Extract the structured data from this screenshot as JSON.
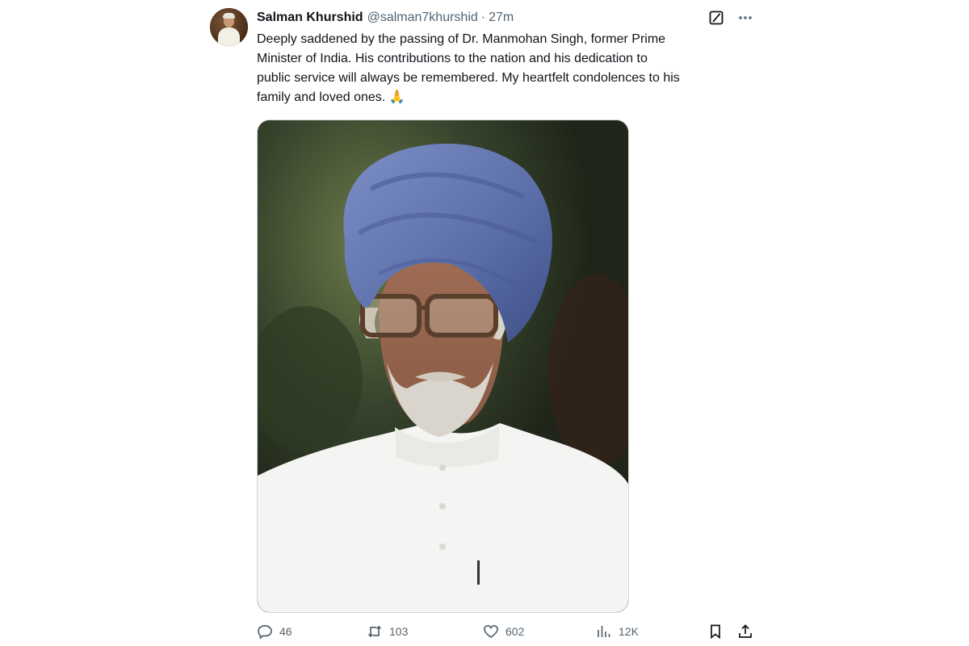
{
  "tweet": {
    "author_name": "Salman Khurshid",
    "author_handle": "@salman7khurshid",
    "separator": "·",
    "time": "27m",
    "text": "Deeply saddened by the passing of Dr. Manmohan Singh, former Prime\nMinister of India. His contributions to the nation and his dedication to\npublic service will always be remembered. My heartfelt condolences to his\nfamily and loved ones. 🙏"
  },
  "top_actions": {
    "grok_icon": "grok-icon",
    "more_icon": "more-icon"
  },
  "media": {
    "subject": "photo-portrait"
  },
  "metrics": {
    "replies": "46",
    "reposts": "103",
    "likes": "602",
    "views": "12K"
  },
  "icons": {
    "reply": "reply-icon",
    "repost": "repost-icon",
    "like": "heart-icon",
    "views": "views-icon",
    "bookmark": "bookmark-icon",
    "share": "share-icon"
  },
  "colors": {
    "text_primary": "#0f1419",
    "text_secondary": "#536471",
    "border": "#cfd9de"
  }
}
